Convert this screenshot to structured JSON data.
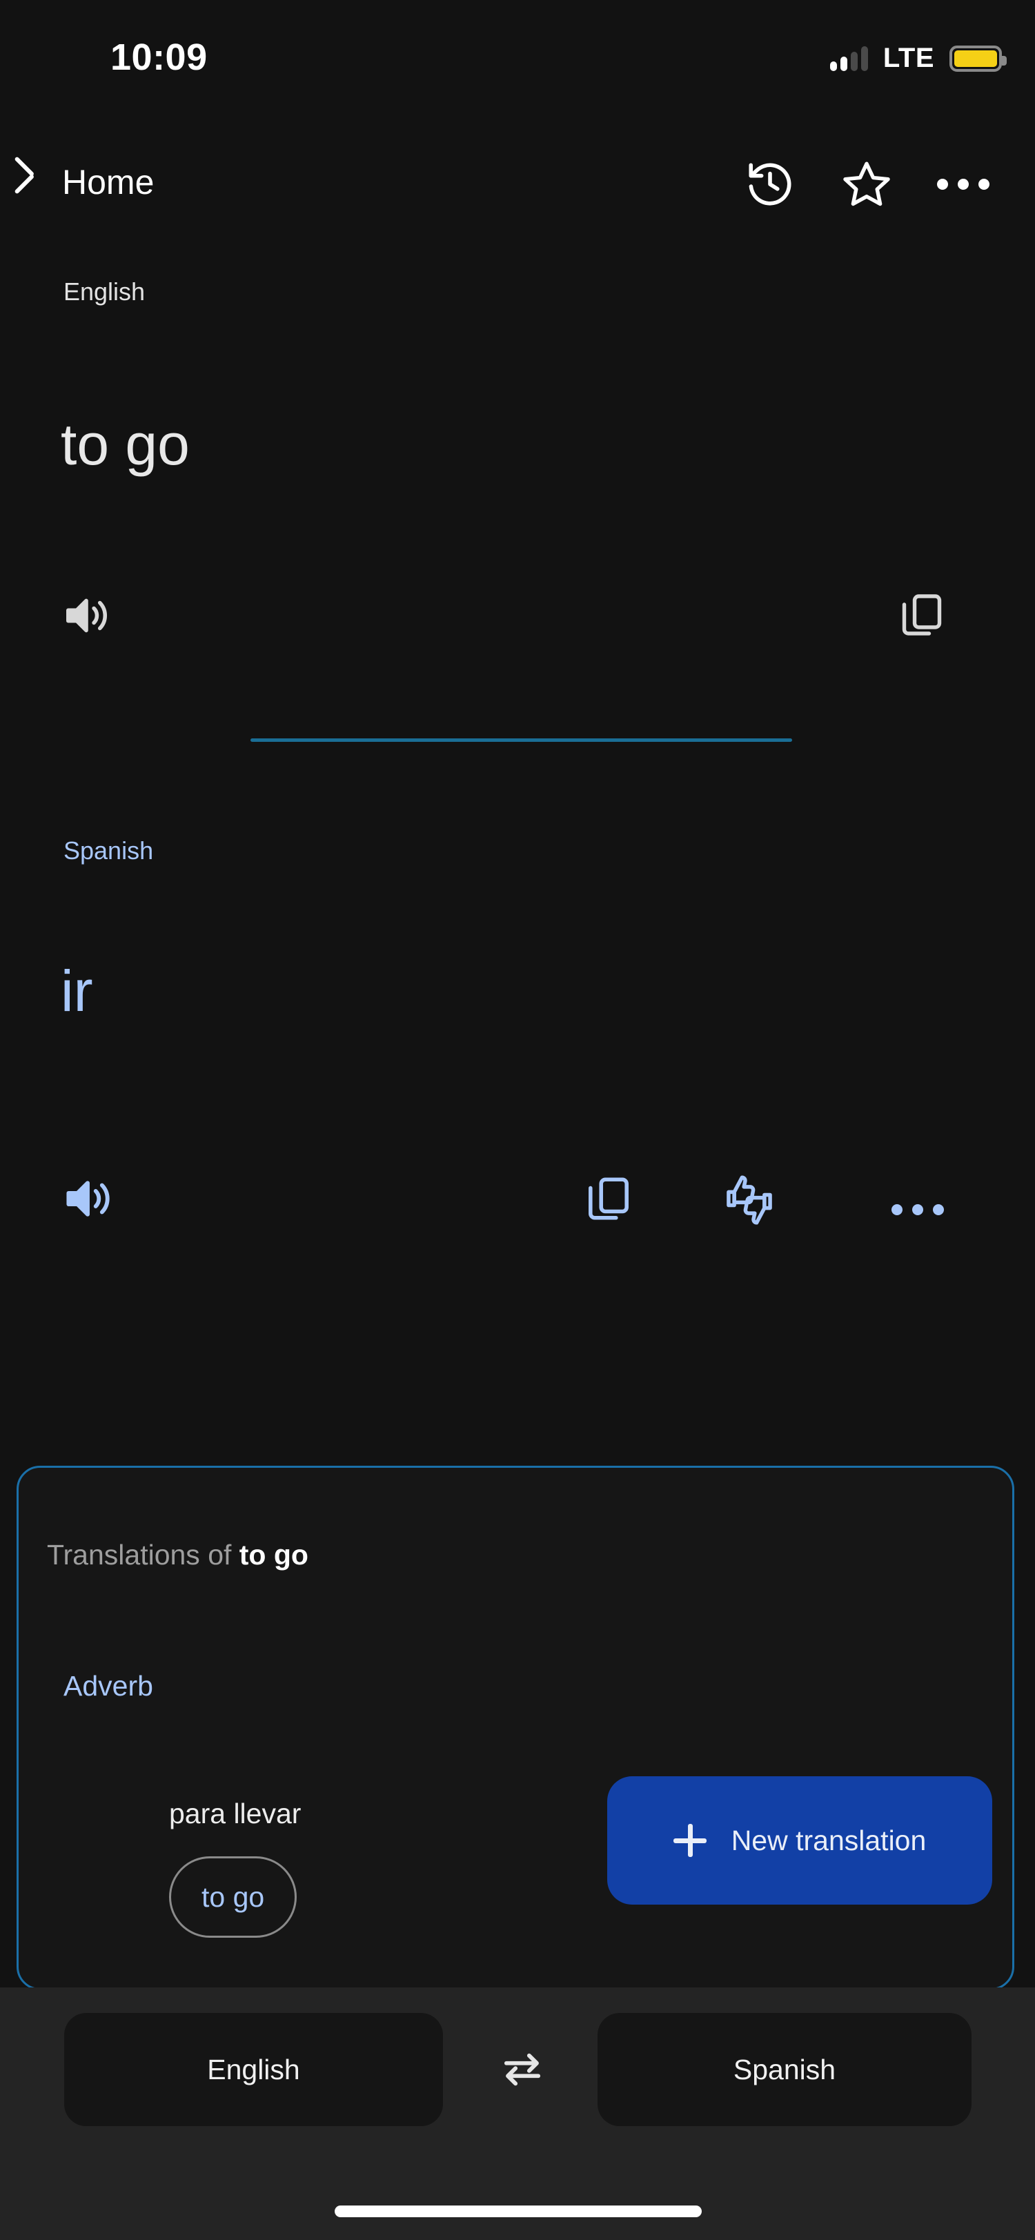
{
  "status_bar": {
    "time": "10:09",
    "network": "LTE",
    "signal_bars_active": 2,
    "signal_bars_total": 4,
    "battery_color": "#f5d016",
    "battery_state": "low-power-yellow"
  },
  "nav_bar": {
    "back_label": "Home",
    "back_icon": "chevron-left-icon",
    "actions": [
      {
        "name": "history-icon",
        "label": "History"
      },
      {
        "name": "star-icon",
        "label": "Save"
      },
      {
        "name": "more-icon",
        "label": "More options"
      }
    ]
  },
  "source_panel": {
    "language_label": "English",
    "text": "to go",
    "actions": [
      {
        "name": "speaker-icon",
        "label": "Listen"
      },
      {
        "name": "copy-icon",
        "label": "Copy"
      }
    ]
  },
  "target_panel": {
    "language_label": "Spanish",
    "text": "ir",
    "accent_color": "#a8c7fa",
    "actions": [
      {
        "name": "speaker-icon",
        "label": "Listen"
      },
      {
        "name": "copy-icon",
        "label": "Copy"
      },
      {
        "name": "thumbs-feedback-icon",
        "label": "Rate this translation"
      },
      {
        "name": "more-icon",
        "label": "More options"
      }
    ]
  },
  "divider_color": "#1a6e96",
  "translations_card": {
    "border_color": "#1a6fa8",
    "title_prefix": "Translations of ",
    "title_term": "to go",
    "part_of_speech": "Adverb",
    "entries": [
      {
        "term": "para llevar",
        "chip": "to go"
      }
    ],
    "new_translation": {
      "label": "New translation",
      "icon": "plus-icon",
      "background": "#1240a6"
    }
  },
  "bottom_bar": {
    "source_language": "English",
    "target_language": "Spanish",
    "swap_icon": "swap-arrows-icon"
  }
}
